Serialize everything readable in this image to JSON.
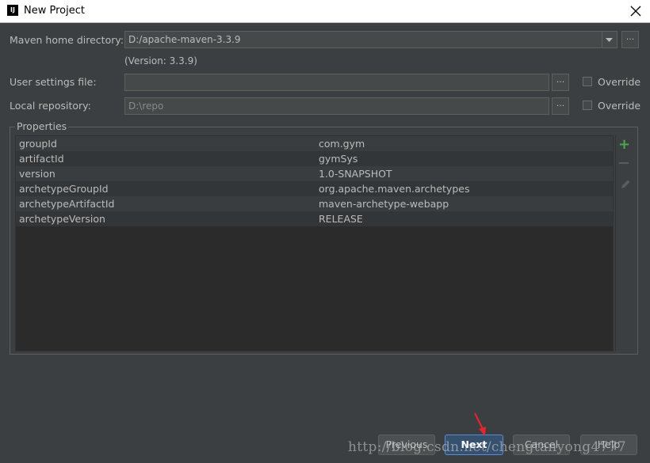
{
  "window": {
    "title": "New Project",
    "icon": "intellij-icon",
    "icon_text": "IJ"
  },
  "maven_home": {
    "label": "Maven home directory:",
    "value": "D:/apache-maven-3.3.9",
    "version": "(Version: 3.3.9)"
  },
  "user_settings": {
    "label": "User settings file:",
    "value": "",
    "override_label": "Override"
  },
  "local_repo": {
    "label": "Local repository:",
    "value": "D:\\repo",
    "override_label": "Override"
  },
  "browse_label": "...",
  "properties": {
    "title": "Properties",
    "rows": [
      {
        "key": "groupId",
        "value": "com.gym"
      },
      {
        "key": "artifactId",
        "value": "gymSys"
      },
      {
        "key": "version",
        "value": "1.0-SNAPSHOT"
      },
      {
        "key": "archetypeGroupId",
        "value": "org.apache.maven.archetypes"
      },
      {
        "key": "archetypeArtifactId",
        "value": "maven-archetype-webapp"
      },
      {
        "key": "archetypeVersion",
        "value": "RELEASE"
      }
    ],
    "add_icon": "+"
  },
  "buttons": {
    "previous": "Previous",
    "next": "Next",
    "cancel": "Cancel",
    "help": "Help"
  },
  "watermark": "http://blog.csdn.net/chengtanyong4777",
  "colors": {
    "background": "#3c3f41",
    "add": "#4ca64c",
    "arrow": "#e3262b",
    "primary_border": "#5b8bd4"
  }
}
